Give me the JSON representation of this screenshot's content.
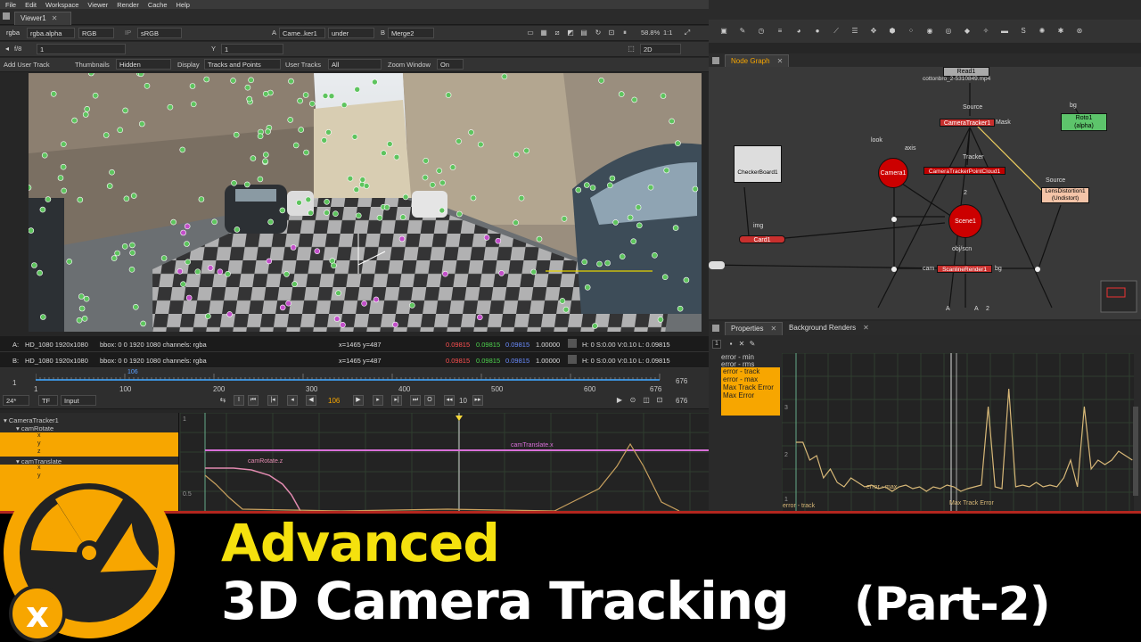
{
  "menu": [
    "File",
    "Edit",
    "Workspace",
    "Viewer",
    "Render",
    "Cache",
    "Help"
  ],
  "viewer_tab": "Viewer1",
  "viewer_toolbar": {
    "channels": "rgba",
    "alpha": "rgba.alpha",
    "colorspace_mode": "RGB",
    "ip": "IP",
    "lut": "sRGB",
    "input_a": "A",
    "input_a_node": "Came..ker1",
    "composite": "under",
    "input_b": "B",
    "input_b_node": "Merge2",
    "zoom": "58.8%",
    "ratio": "1:1",
    "fstop": "f/8",
    "frame_val": "1",
    "y_label": "Y",
    "y_val": "1",
    "view_mode": "2D"
  },
  "track_toolbar": {
    "add_user_track": "Add User Track",
    "thumbnails_label": "Thumbnails",
    "thumbnails_val": "Hidden",
    "display_label": "Display",
    "display_val": "Tracks and Points",
    "user_tracks_label": "User Tracks",
    "user_tracks_val": "All",
    "zoom_window_label": "Zoom Window",
    "zoom_window_val": "On"
  },
  "info_a": {
    "prefix": "A:",
    "format": "HD_1080 1920x1080",
    "bbox": "bbox: 0 0 1920 1080 channels: rgba",
    "coords": "x=1465 y=487",
    "r": "0.09815",
    "g": "0.09815",
    "b": "0.09815",
    "a": "1.00000",
    "hsv": "H:  0 S:0.00 V:0.10  L: 0.09815"
  },
  "info_b": {
    "prefix": "B:",
    "format": "HD_1080 1920x1080",
    "bbox": "bbox: 0 0 1920 1080 channels: rgba",
    "coords": "x=1465 y=487",
    "r": "0.09815",
    "g": "0.09815",
    "b": "0.09815",
    "a": "1.00000",
    "hsv": "H:  0 S:0.00 V:0.10  L: 0.09815"
  },
  "timeline": {
    "start": "1",
    "ticks": [
      "1",
      "100",
      "200",
      "300",
      "400",
      "500",
      "600",
      "676"
    ],
    "current": "106",
    "end": "676",
    "left_val": "1"
  },
  "playback": {
    "fps": "24*",
    "tf": "TF",
    "input": "Input",
    "frame": "106",
    "step": "10",
    "end": "676"
  },
  "curve_tree": {
    "node": "CameraTracker1",
    "group1": "camRotate",
    "group1_items": [
      "x",
      "y",
      "z"
    ],
    "group2": "camTranslate",
    "group2_items": [
      "x",
      "y"
    ]
  },
  "curve_labels": {
    "translate": "camTranslate.x",
    "rotate": "camRotate.z",
    "y1": "1",
    "y05": "0.5"
  },
  "node_graph_tab": "Node Graph",
  "nodes": {
    "read": "Read1",
    "read_file": "cottonbro_2-5310849.mp4",
    "source_label": "Source",
    "camtracker": "CameraTracker1",
    "mask_label": "Mask",
    "bg_label": "bg",
    "roto": "Roto1",
    "roto_sub": "(alpha)",
    "look_label": "look",
    "axis_label": "axis",
    "camera": "Camera1",
    "tracker_label": "Tracker",
    "pointcloud": "CameraTrackerPointCloud1",
    "checker": "CheckerBoard1",
    "source2_label": "Source",
    "lensdist": "LensDistortion1",
    "lensdist_sub": "(Undistort)",
    "two_label": "2",
    "scene": "Scene1",
    "img_label": "img",
    "card": "Card1",
    "objscn_label": "obj/scn",
    "cam_label": "cam",
    "scanline": "ScanlineRender1",
    "bg2_label": "bg",
    "a1": "A",
    "a2": "A",
    "a3": "2"
  },
  "properties_tab": "Properties",
  "bg_renders_tab": "Background Renders",
  "props_count": "1",
  "error_list": [
    "error - min",
    "error - rms",
    "error - track",
    "error - max",
    "Max Track Error",
    "Max Error"
  ],
  "error_curve_labels": {
    "error_max": "error - max",
    "error_track": "error - track",
    "max_track": "Max Track Error",
    "y3": "3",
    "y2": "2",
    "y1": "1"
  },
  "banner": {
    "line1": "Advanced",
    "line2": "3D Camera Tracking",
    "line3": "(Part-2)"
  },
  "colors": {
    "accent_orange": "#f7a600",
    "node_red": "#c00000",
    "point_green": "#5ec45e",
    "point_magenta": "#c24fc9",
    "banner_yellow": "#f5e10e"
  }
}
